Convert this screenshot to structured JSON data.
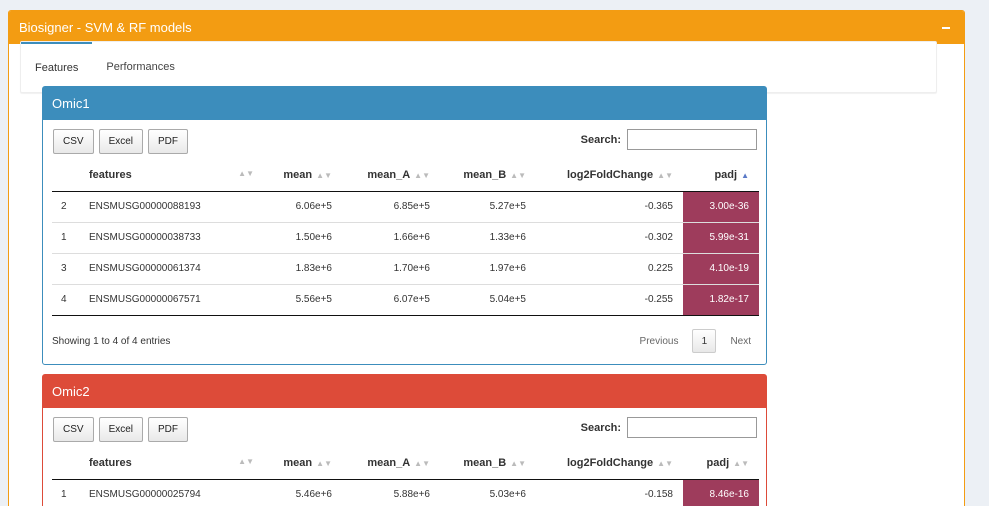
{
  "outer": {
    "title": "Biosigner - SVM & RF models",
    "collapse": "−"
  },
  "tabs": [
    {
      "label": "Features"
    },
    {
      "label": "Performances"
    }
  ],
  "buttons": {
    "csv": "CSV",
    "excel": "Excel",
    "pdf": "PDF"
  },
  "search_label": "Search:",
  "columns": [
    "features",
    "mean",
    "mean_A",
    "mean_B",
    "log2FoldChange",
    "padj"
  ],
  "colors": {
    "header_orange": "#f39c12",
    "omic1_blue": "#3c8dbc",
    "omic2_red": "#dd4b39",
    "padj_cell": "#9e3c5c"
  },
  "omic1": {
    "title": "Omic1",
    "rows": [
      {
        "idx": "2",
        "features": "ENSMUSG00000088193",
        "mean": "6.06e+5",
        "mean_A": "6.85e+5",
        "mean_B": "5.27e+5",
        "log2FoldChange": "-0.365",
        "padj": "3.00e-36"
      },
      {
        "idx": "1",
        "features": "ENSMUSG00000038733",
        "mean": "1.50e+6",
        "mean_A": "1.66e+6",
        "mean_B": "1.33e+6",
        "log2FoldChange": "-0.302",
        "padj": "5.99e-31"
      },
      {
        "idx": "3",
        "features": "ENSMUSG00000061374",
        "mean": "1.83e+6",
        "mean_A": "1.70e+6",
        "mean_B": "1.97e+6",
        "log2FoldChange": "0.225",
        "padj": "4.10e-19"
      },
      {
        "idx": "4",
        "features": "ENSMUSG00000067571",
        "mean": "5.56e+5",
        "mean_A": "6.07e+5",
        "mean_B": "5.04e+5",
        "log2FoldChange": "-0.255",
        "padj": "1.82e-17"
      }
    ],
    "info": "Showing 1 to 4 of 4 entries",
    "pager": {
      "previous": "Previous",
      "page": "1",
      "next": "Next"
    }
  },
  "omic2": {
    "title": "Omic2",
    "rows": [
      {
        "idx": "1",
        "features": "ENSMUSG00000025794",
        "mean": "5.46e+6",
        "mean_A": "5.88e+6",
        "mean_B": "5.03e+6",
        "log2FoldChange": "-0.158",
        "padj": "8.46e-16"
      }
    ]
  }
}
